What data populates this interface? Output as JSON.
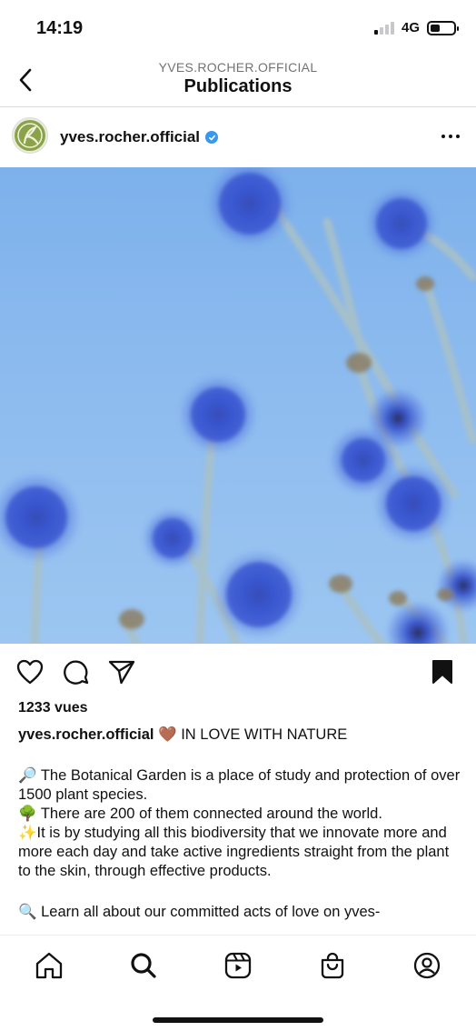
{
  "status_bar": {
    "time": "14:19",
    "network": "4G"
  },
  "nav": {
    "subtitle": "YVES.ROCHER.OFFICIAL",
    "title": "Publications"
  },
  "post": {
    "username": "yves.rocher.official",
    "views": "1233 vues",
    "caption_title": "🤎 IN LOVE WITH NATURE",
    "caption_lines": [
      "🔎 The Botanical Garden is a place of study and protection of over 1500 plant species.",
      "🌳 There are 200 of them connected around the world.",
      "✨It is by studying all this biodiversity that we innovate more and more each day and take active ingredients straight from the plant to the skin, through effective products."
    ],
    "caption_more": "🔍 Learn all about our committed acts of love on yves-"
  },
  "icons": {
    "back": "chevron-left-icon",
    "more": "more-horizontal-icon",
    "like": "heart-icon",
    "comment": "comment-icon",
    "share": "send-icon",
    "save": "bookmark-icon",
    "tabs": [
      "home-icon",
      "search-icon",
      "reels-icon",
      "shop-icon",
      "profile-icon"
    ]
  },
  "colors": {
    "verified": "#3897f0",
    "sky": "#8dbbef",
    "flower": "#3b5ad8"
  }
}
